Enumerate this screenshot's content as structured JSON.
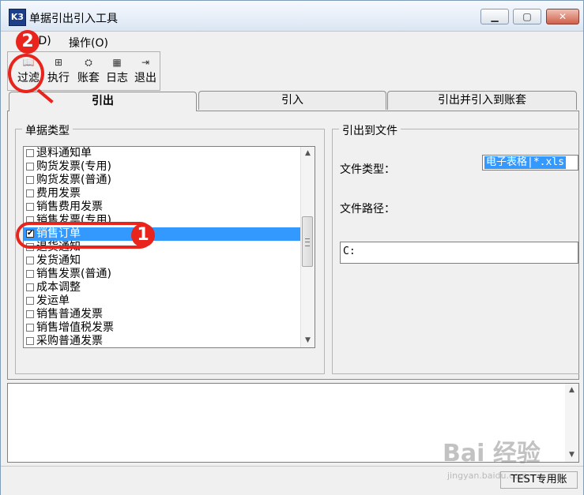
{
  "window": {
    "title": "单据引出引入工具",
    "icon_label": "K3",
    "min_glyph": "▁",
    "max_glyph": "▢",
    "close_glyph": "✕"
  },
  "menu": {
    "items": [
      {
        "label": "(D)"
      },
      {
        "label": "操作(O)"
      }
    ]
  },
  "toolbar": {
    "items": [
      {
        "label": "过滤",
        "icon": "book-icon",
        "glyph": "📖"
      },
      {
        "label": "执行",
        "icon": "grid-icon",
        "glyph": "⊞"
      },
      {
        "label": "账套",
        "icon": "accounts-icon",
        "glyph": "⛭"
      },
      {
        "label": "日志",
        "icon": "calendar-icon",
        "glyph": "▦"
      },
      {
        "label": "退出",
        "icon": "exit-icon",
        "glyph": "⇥"
      }
    ]
  },
  "tabs": [
    {
      "label": "引出",
      "active": true
    },
    {
      "label": "引入",
      "active": false
    },
    {
      "label": "引出并引入到账套",
      "active": false
    }
  ],
  "doc_types": {
    "title": "单据类型",
    "items": [
      {
        "label": "退料通知单",
        "checked": false
      },
      {
        "label": "购货发票(专用)",
        "checked": false
      },
      {
        "label": "购货发票(普通)",
        "checked": false
      },
      {
        "label": "费用发票",
        "checked": false
      },
      {
        "label": "销售费用发票",
        "checked": false
      },
      {
        "label": "销售发票(专用)",
        "checked": false
      },
      {
        "label": "销售订单",
        "checked": true
      },
      {
        "label": "退货通知",
        "checked": false
      },
      {
        "label": "发货通知",
        "checked": false
      },
      {
        "label": "销售发票(普通)",
        "checked": false
      },
      {
        "label": "成本调整",
        "checked": false
      },
      {
        "label": "发运单",
        "checked": false
      },
      {
        "label": "销售普通发票",
        "checked": false
      },
      {
        "label": "销售增值税发票",
        "checked": false
      },
      {
        "label": "采购普通发票",
        "checked": false
      }
    ],
    "scroll_up": "▲",
    "scroll_down": "▼"
  },
  "export": {
    "title": "引出到文件",
    "file_type_label": "文件类型：",
    "file_type_value": "电子表格|*.xls",
    "file_path_label": "文件路径：",
    "file_path_value": "C:"
  },
  "log": {
    "up": "▲",
    "down": "▼"
  },
  "status": {
    "account": "TEST专用账"
  },
  "annotations": {
    "badge1": "1",
    "badge2": "2",
    "color": "#e8241c"
  },
  "watermark": {
    "text": "Bai 经验",
    "sub": "jingyan.baidu.com"
  }
}
